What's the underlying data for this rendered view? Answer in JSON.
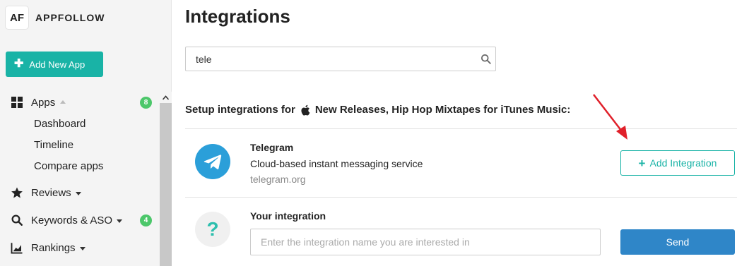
{
  "brand": {
    "logo_letters": "AF",
    "name": "APPFOLLOW"
  },
  "sidebar": {
    "add_app_label": "Add New App",
    "items": [
      {
        "label": "Apps",
        "icon": "grid-icon",
        "badge": "8",
        "expanded": true
      },
      {
        "label": "Reviews",
        "icon": "star-icon"
      },
      {
        "label": "Keywords & ASO",
        "icon": "search-icon",
        "badge": "4"
      },
      {
        "label": "Rankings",
        "icon": "chart-icon"
      }
    ],
    "apps_subitems": [
      "Dashboard",
      "Timeline",
      "Compare apps"
    ]
  },
  "main": {
    "title": "Integrations",
    "search": {
      "value": "tele",
      "placeholder": ""
    },
    "setup_prefix": "Setup integrations for",
    "app_name": "New Releases, Hip Hop Mixtapes for iTunes Music:",
    "telegram": {
      "title": "Telegram",
      "description": "Cloud-based instant messaging service",
      "link": "telegram.org",
      "button_label": "Add Integration"
    },
    "your_integration": {
      "title": "Your integration",
      "placeholder": "Enter the integration name you are interested in",
      "button_label": "Send"
    }
  },
  "colors": {
    "accent": "#19b3a6",
    "send_button": "#2f86c8",
    "badge": "#4cc76a",
    "telegram": "#2b9fd9",
    "arrow": "#e0202a"
  }
}
